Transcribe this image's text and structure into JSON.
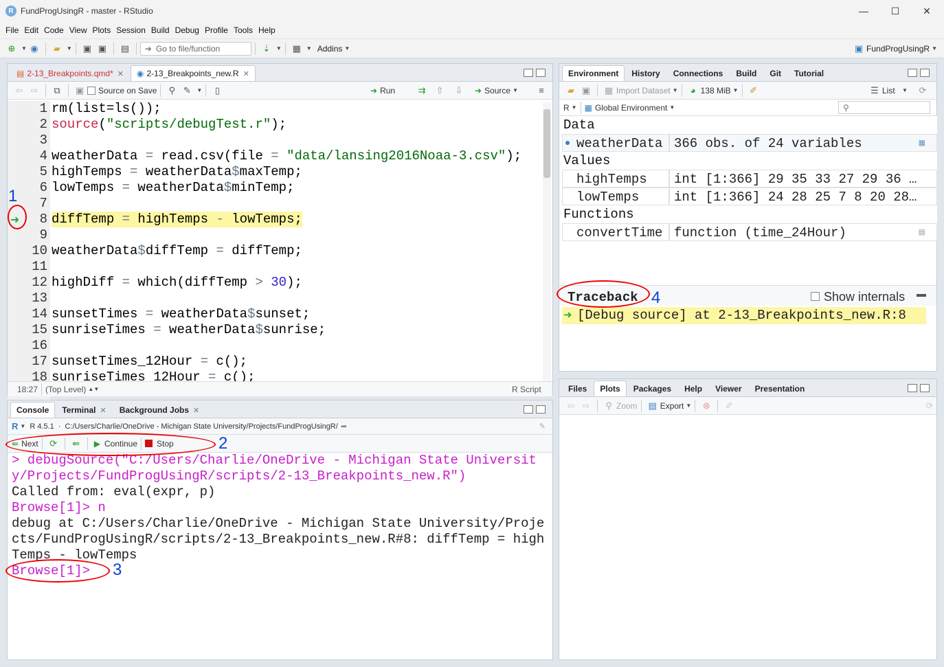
{
  "window": {
    "title": "FundProgUsingR - master - RStudio",
    "logo": "R"
  },
  "menu": [
    "File",
    "Edit",
    "Code",
    "View",
    "Plots",
    "Session",
    "Build",
    "Debug",
    "Profile",
    "Tools",
    "Help"
  ],
  "toolbar": {
    "goto_placeholder": "Go to file/function",
    "addins_label": "Addins",
    "project_label": "FundProgUsingR"
  },
  "editor": {
    "tabs": [
      {
        "label": "2-13_Breakpoints.qmd*",
        "active": false
      },
      {
        "label": "2-13_Breakpoints_new.R",
        "active": true
      }
    ],
    "source_on_save": "Source on Save",
    "run_label": "Run",
    "source_label": "Source",
    "lines": [
      {
        "n": "1",
        "text": "rm(list=ls());"
      },
      {
        "n": "2",
        "text": "source(\"scripts/debugTest.r\");"
      },
      {
        "n": "3",
        "text": ""
      },
      {
        "n": "4",
        "text": "weatherData = read.csv(file = \"data/lansing2016Noaa-3.csv\");"
      },
      {
        "n": "5",
        "text": "highTemps = weatherData$maxTemp;"
      },
      {
        "n": "6",
        "text": "lowTemps = weatherData$minTemp;"
      },
      {
        "n": "7",
        "text": ""
      },
      {
        "n": "8",
        "text": "diffTemp = highTemps - lowTemps;"
      },
      {
        "n": "9",
        "text": ""
      },
      {
        "n": "10",
        "text": "weatherData$diffTemp = diffTemp;"
      },
      {
        "n": "11",
        "text": ""
      },
      {
        "n": "12",
        "text": "highDiff = which(diffTemp > 30);"
      },
      {
        "n": "13",
        "text": ""
      },
      {
        "n": "14",
        "text": "sunsetTimes = weatherData$sunset;"
      },
      {
        "n": "15",
        "text": "sunriseTimes = weatherData$sunrise;"
      },
      {
        "n": "16",
        "text": ""
      },
      {
        "n": "17",
        "text": "sunsetTimes_12Hour = c();"
      },
      {
        "n": "18",
        "text": "sunriseTimes_12Hour = c();"
      }
    ],
    "status_pos": "18:27",
    "status_scope": "(Top Level)",
    "status_type": "R Script"
  },
  "console": {
    "tabs": [
      {
        "label": "Console",
        "active": true
      },
      {
        "label": "Terminal",
        "active": false
      },
      {
        "label": "Background Jobs",
        "active": false
      }
    ],
    "r_version": "R 4.5.1",
    "path": "C:/Users/Charlie/OneDrive - Michigan State University/Projects/FundProgUsingR/",
    "debug_next": "Next",
    "debug_continue": "Continue",
    "debug_stop": "Stop",
    "lines": [
      {
        "text": "> debugSource(\"C:/Users/Charlie/OneDrive - Michigan State Universit",
        "kind": "prompt"
      },
      {
        "text": "y/Projects/FundProgUsingR/scripts/2-13_Breakpoints_new.R\")",
        "kind": "prompt"
      },
      {
        "text": "Called from: eval(expr, p)",
        "kind": "out"
      },
      {
        "text": "Browse[1]> n",
        "kind": "prompt"
      },
      {
        "text": "debug at C:/Users/Charlie/OneDrive - Michigan State University/Proje",
        "kind": "out"
      },
      {
        "text": "cts/FundProgUsingR/scripts/2-13_Breakpoints_new.R#8: diffTemp = high",
        "kind": "out"
      },
      {
        "text": "Temps - lowTemps",
        "kind": "out"
      },
      {
        "text": "Browse[1]> ",
        "kind": "prompt"
      }
    ]
  },
  "environment": {
    "tabs": [
      "Environment",
      "History",
      "Connections",
      "Build",
      "Git",
      "Tutorial"
    ],
    "import_label": "Import Dataset",
    "memory_label": "138 MiB",
    "list_label": "List",
    "lang_label": "R",
    "scope_label": "Global Environment",
    "sections": {
      "data": "Data",
      "values": "Values",
      "functions": "Functions"
    },
    "rows": {
      "weatherData": {
        "name": "weatherData",
        "value": "366 obs. of 24 variables"
      },
      "highTemps": {
        "name": "highTemps",
        "value": "int [1:366] 29 35 33 27 29 36 …"
      },
      "lowTemps": {
        "name": "lowTemps",
        "value": "int [1:366] 24 28 25 7 8 20 28…"
      },
      "convertTime": {
        "name": "convertTime",
        "value": "function (time_24Hour)"
      }
    },
    "traceback_label": "Traceback",
    "show_internals": "Show internals",
    "traceback_entry": "[Debug source] at 2-13_Breakpoints_new.R:8"
  },
  "files": {
    "tabs": [
      "Files",
      "Plots",
      "Packages",
      "Help",
      "Viewer",
      "Presentation"
    ],
    "active": "Plots",
    "zoom_label": "Zoom",
    "export_label": "Export"
  },
  "annotations": [
    "1",
    "2",
    "3",
    "4"
  ],
  "colors": {
    "highlight": "#fdf6a3",
    "annotation_red": "#e00000",
    "annotation_blue": "#1240d8",
    "debug_arrow": "#1db23f",
    "prompt": "#c81ecb"
  }
}
